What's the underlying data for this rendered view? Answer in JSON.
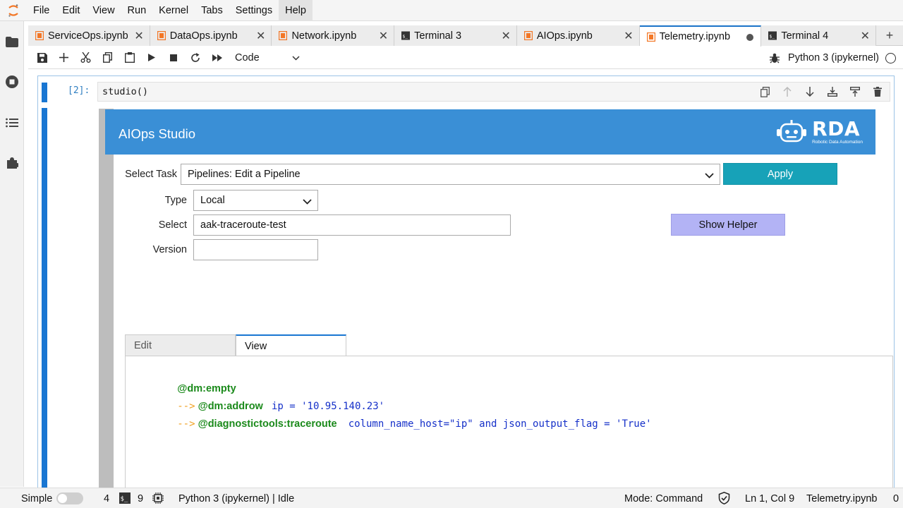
{
  "menubar": {
    "items": [
      "File",
      "Edit",
      "View",
      "Run",
      "Kernel",
      "Tabs",
      "Settings",
      "Help"
    ],
    "active": "Help"
  },
  "tabs": [
    {
      "label": "ServiceOps.ipynb",
      "icon": "notebook-icon",
      "state": "close"
    },
    {
      "label": "DataOps.ipynb",
      "icon": "notebook-icon",
      "state": "close"
    },
    {
      "label": "Network.ipynb",
      "icon": "notebook-icon",
      "state": "close"
    },
    {
      "label": "Terminal 3",
      "icon": "terminal-icon",
      "state": "close"
    },
    {
      "label": "AIOps.ipynb",
      "icon": "notebook-icon",
      "state": "close"
    },
    {
      "label": "Telemetry.ipynb",
      "icon": "notebook-icon",
      "state": "dirty"
    },
    {
      "label": "Terminal 4",
      "icon": "terminal-icon",
      "state": "close"
    }
  ],
  "toolbar": {
    "cell_type": "Code",
    "kernel_name": "Python 3 (ipykernel)"
  },
  "cell": {
    "prompt": "[2]:",
    "source": "studio()"
  },
  "studio": {
    "banner_title": "AIOps Studio",
    "logo_word": "RDA",
    "logo_sub": "Robotic Data Automation",
    "select_task_label": "Select Task",
    "select_task_value": "Pipelines: Edit a Pipeline",
    "apply_label": "Apply",
    "type_label": "Type",
    "type_value": "Local",
    "select_label": "Select",
    "select_value": "aak-traceroute-test",
    "show_helper_label": "Show Helper",
    "version_label": "Version",
    "version_value": "",
    "tab_edit": "Edit",
    "tab_view": "View",
    "pipeline": {
      "line1_cmd": "@dm:empty",
      "line2_arrow": "-->",
      "line2_cmd": "@dm:addrow",
      "line2_args": "ip = '10.95.140.23'",
      "line3_arrow": "-->",
      "line3_cmd": "@diagnostictools:traceroute",
      "line3_args": "column_name_host=\"ip\" and json_output_flag = 'True'"
    }
  },
  "statusbar": {
    "mode_label": "Simple",
    "count1": "4",
    "count2": "9",
    "kernel_status": "Python 3 (ipykernel) | Idle",
    "mode": "Mode: Command",
    "cursor": "Ln 1, Col 9",
    "file": "Telemetry.ipynb",
    "notifications": "0"
  },
  "colors": {
    "accent": "#1976d2",
    "banner": "#3a8fd6",
    "apply": "#17a2b8",
    "helper": "#b3b3f5",
    "keyword": "#1b8a1b",
    "arrow": "#f0a020",
    "args": "#1530c9"
  }
}
